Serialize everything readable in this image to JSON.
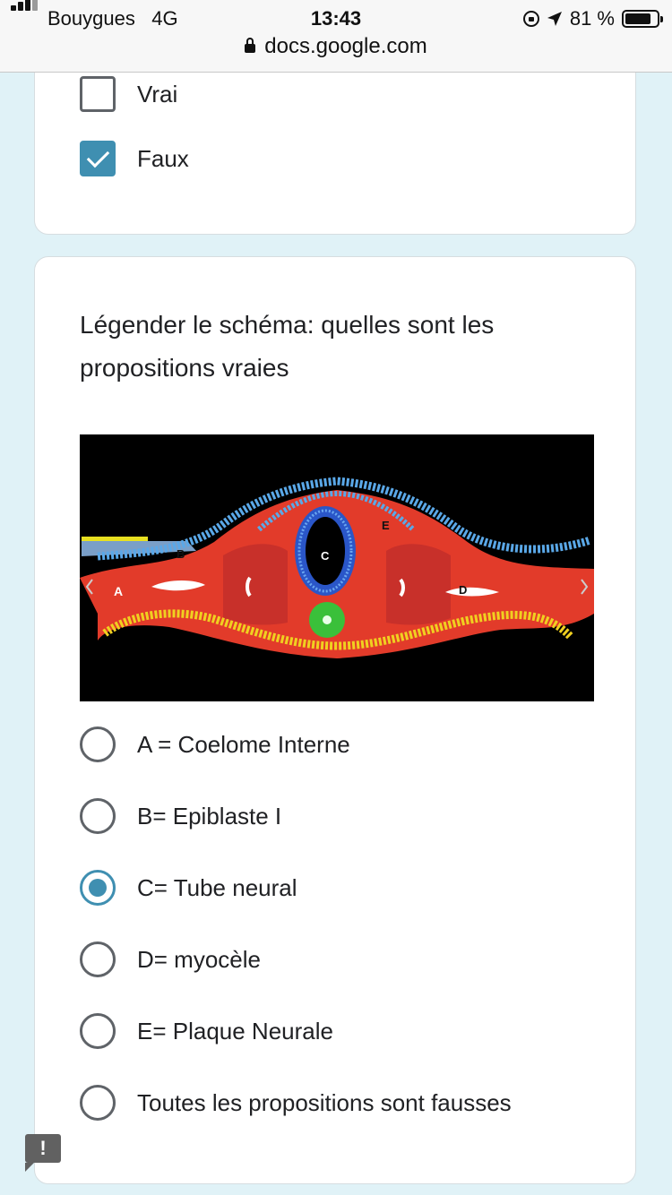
{
  "status_bar": {
    "carrier": "Bouygues",
    "network": "4G",
    "time": "13:43",
    "battery": "81 %",
    "battery_level": 0.81
  },
  "browser": {
    "url": "docs.google.com"
  },
  "previous_question": {
    "options": [
      {
        "label": "Vrai",
        "checked": false
      },
      {
        "label": "Faux",
        "checked": true
      }
    ]
  },
  "question": {
    "title": "Légender le schéma: quelles sont les propositions vraies",
    "figure_labels": [
      "A",
      "B",
      "C",
      "D",
      "E"
    ],
    "options": [
      {
        "label": "A = Coelome Interne",
        "selected": false
      },
      {
        "label": "B= Epiblaste I",
        "selected": false
      },
      {
        "label": "C= Tube neural",
        "selected": true
      },
      {
        "label": "D= myocèle",
        "selected": false
      },
      {
        "label": "E= Plaque Neurale",
        "selected": false
      },
      {
        "label": "Toutes les propositions sont fausses",
        "selected": false
      }
    ]
  },
  "feedback_button": {
    "icon": "!"
  },
  "colors": {
    "accent": "#3f8fb1",
    "background": "#e0f2f7"
  }
}
